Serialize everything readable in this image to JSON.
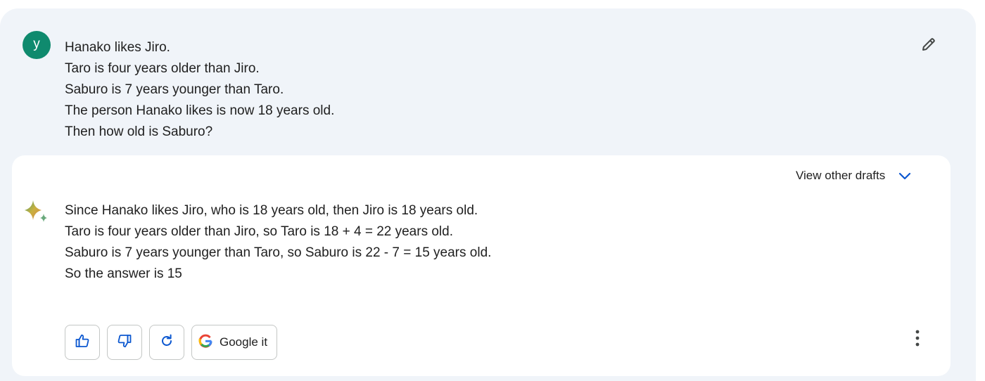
{
  "user": {
    "avatar_letter": "y",
    "prompt_lines": [
      "Hanako likes Jiro.",
      "Taro is four years older than Jiro.",
      "Saburo is 7 years younger than Taro.",
      "The person Hanako likes is now 18 years old.",
      "Then how old is Saburo?"
    ],
    "edit_icon": "pencil-icon"
  },
  "response": {
    "view_drafts_label": "View other drafts",
    "drafts_icon": "chevron-down-icon",
    "assistant_icon": "sparkle-icon",
    "answer_lines": [
      "Since Hanako likes Jiro, who is 18 years old, then Jiro is 18 years old.",
      "Taro is four years older than Jiro, so Taro is 18 + 4 = 22 years old.",
      "Saburo is 7 years younger than Taro, so Saburo is 22 - 7 = 15 years old.",
      "So the answer is 15"
    ],
    "actions": {
      "thumbs_up_icon": "thumbs-up-icon",
      "thumbs_down_icon": "thumbs-down-icon",
      "regenerate_icon": "refresh-icon",
      "google_label": "Google it",
      "more_icon": "more-vert-icon"
    }
  },
  "colors": {
    "panel_bg": "#f0f4f9",
    "avatar_bg": "#0f8a6e",
    "accent_blue": "#0b57d0",
    "text": "#1f1f1f"
  }
}
